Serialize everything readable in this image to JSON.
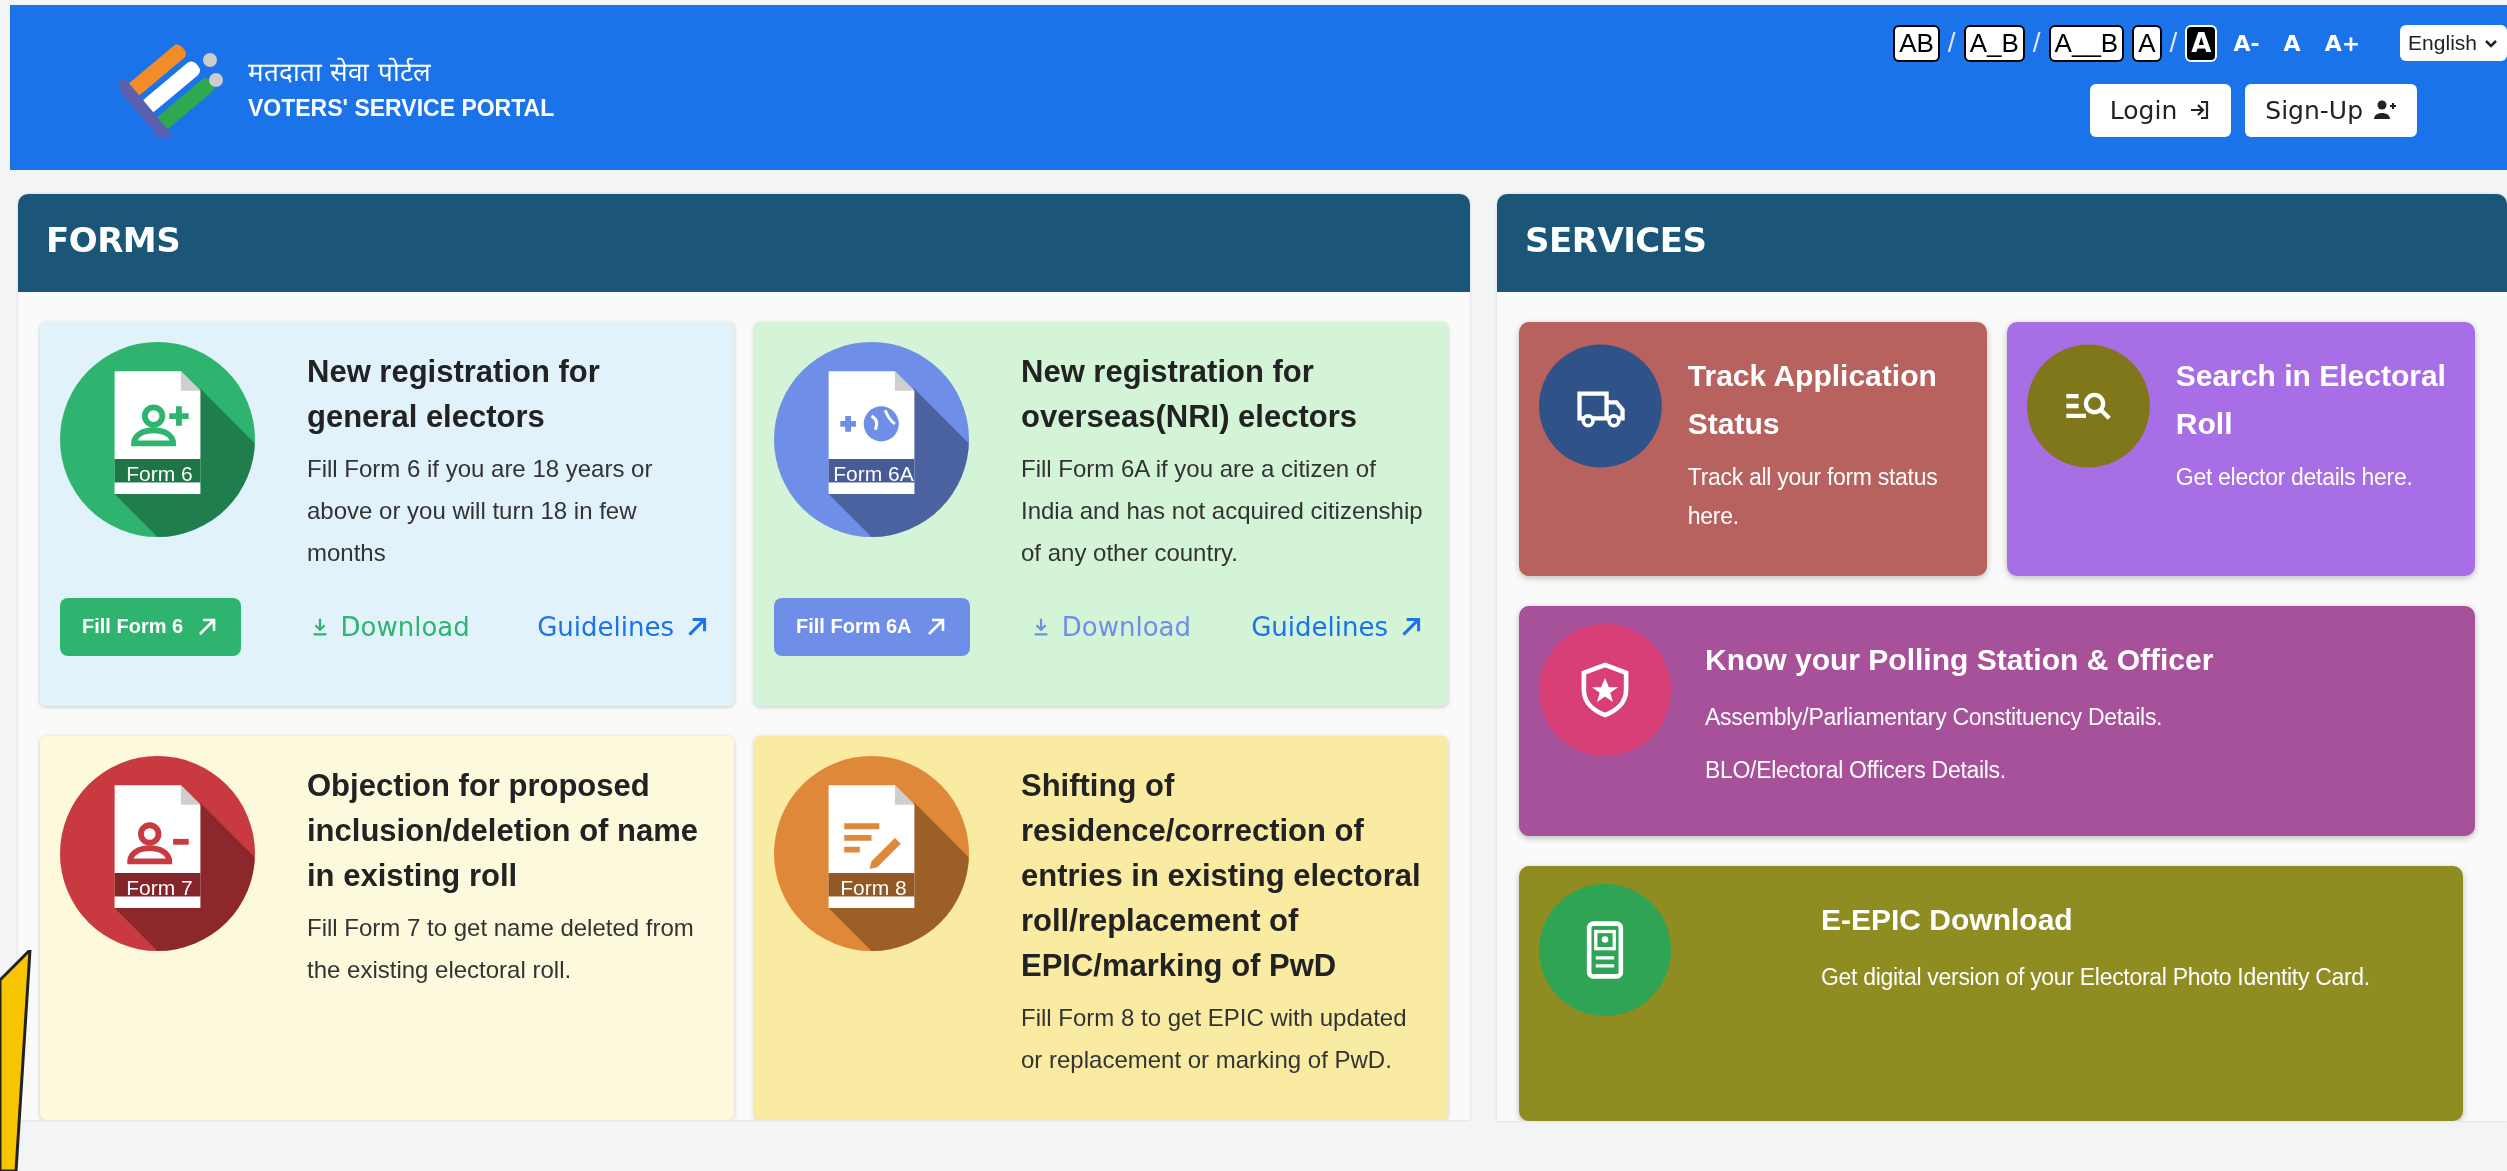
{
  "header": {
    "title_hindi": "मतदाता सेवा पोर्टल",
    "title": "VOTERS' SERVICE PORTAL",
    "accessibility": [
      {
        "kind": "box",
        "label": "AB"
      },
      {
        "kind": "sep",
        "label": "/"
      },
      {
        "kind": "box",
        "label": "A_B"
      },
      {
        "kind": "sep",
        "label": "/"
      },
      {
        "kind": "box",
        "label": "A__B"
      },
      {
        "kind": "box",
        "label": "A"
      },
      {
        "kind": "sep",
        "label": "/"
      },
      {
        "kind": "inverse",
        "label": "A"
      },
      {
        "kind": "size",
        "label": "A-"
      },
      {
        "kind": "size",
        "label": "A"
      },
      {
        "kind": "size",
        "label": "A+"
      }
    ],
    "language": "English",
    "buttons": [
      {
        "kind": "login",
        "label": "Login"
      },
      {
        "kind": "signup",
        "label": "Sign-Up"
      }
    ]
  },
  "forms": {
    "title": "FORMS",
    "cards": [
      {
        "title": "New registration for general electors",
        "description": "Fill Form 6 if you are 18 years or above or you will turn 18 in few months",
        "form_label": "Form 6",
        "icon": {
          "color": "#2fb46f"
        },
        "color": "#e1f2fb",
        "actions": [
          {
            "kind": "fill",
            "label": "Fill Form 6"
          },
          {
            "kind": "download",
            "label": "Download"
          },
          {
            "kind": "guidelines",
            "label": "Guidelines"
          }
        ]
      },
      {
        "title": "New registration for overseas(NRI) electors",
        "description": "Fill Form 6A if you are a citizen of India and has not acquired citizenship of any other country.",
        "form_label": "Form 6A",
        "icon": {
          "color": "#6e8ee8"
        },
        "color": "#d3f4d6",
        "actions": [
          {
            "kind": "fill",
            "label": "Fill Form 6A"
          },
          {
            "kind": "download",
            "label": "Download"
          },
          {
            "kind": "guidelines",
            "label": "Guidelines"
          }
        ]
      },
      {
        "title": "Objection for proposed inclusion/deletion of name in existing roll",
        "description": "Fill Form 7 to get name deleted from the existing electoral roll.",
        "form_label": "Form 7",
        "icon": {
          "color": "#c93a40"
        },
        "color": "#fdf9dd"
      },
      {
        "title": "Shifting of residence/correction of entries in existing electoral roll/replacement of EPIC/marking of PwD",
        "description": "Fill Form 8 to get EPIC with updated or replacement or marking of PwD.",
        "form_label": "Form 8",
        "icon": {
          "color": "#e0883a"
        },
        "color": "#faeba2"
      }
    ]
  },
  "services": {
    "title": "SERVICES",
    "cards": [
      {
        "kind": "half",
        "title": "Track Application Status",
        "lines": [
          "Track all your form status here."
        ],
        "icon": {
          "color": "#2f5389"
        },
        "color": "#b8625f"
      },
      {
        "kind": "half",
        "title": "Search in Electoral Roll",
        "lines": [
          "Get elector details here."
        ],
        "icon": {
          "color": "#80761a"
        },
        "color": "#a86ee6"
      },
      {
        "kind": "wide",
        "title": "Know your Polling Station & Officer",
        "lines": [
          "Assembly/Parliamentary Constituency Details.",
          "BLO/Electoral Officers Details."
        ],
        "icon": {
          "color": "#d93f77"
        },
        "color": "#a6519a"
      },
      {
        "kind": "wide",
        "title": "E-EPIC Download",
        "lines": [
          "Get digital version of your Electoral Photo Identity Card."
        ],
        "icon": {
          "color": "#2ea454"
        },
        "color": "#8f8c22"
      }
    ]
  }
}
